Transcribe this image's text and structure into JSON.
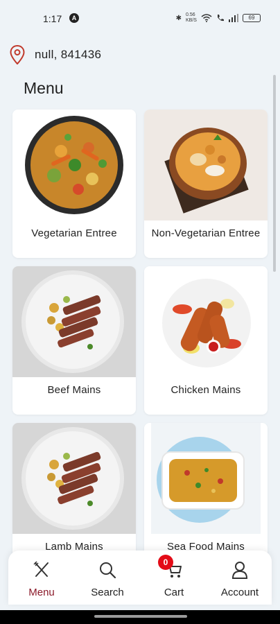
{
  "status_bar": {
    "time": "1:17",
    "notification_badge": "A",
    "network_speed": "0.56 KB/S",
    "battery": "69"
  },
  "location": {
    "text": "null, 841436",
    "icon": "location-pin-icon",
    "icon_color": "#c0392b"
  },
  "menu_title": "Menu",
  "categories": [
    {
      "label": "Vegetarian Entree"
    },
    {
      "label": "Non-Vegetarian Entree"
    },
    {
      "label": "Beef Mains"
    },
    {
      "label": "Chicken Mains"
    },
    {
      "label": "Lamb Mains"
    },
    {
      "label": "Sea Food Mains"
    }
  ],
  "bottom_nav": {
    "items": [
      {
        "label": "Menu",
        "icon": "fork-knife-icon",
        "active": true
      },
      {
        "label": "Search",
        "icon": "search-icon",
        "active": false
      },
      {
        "label": "Cart",
        "icon": "cart-icon",
        "active": false
      },
      {
        "label": "Account",
        "icon": "account-icon",
        "active": false
      }
    ],
    "cart_count": "0",
    "active_color": "#8b1a2a",
    "badge_color": "#e30b17"
  }
}
